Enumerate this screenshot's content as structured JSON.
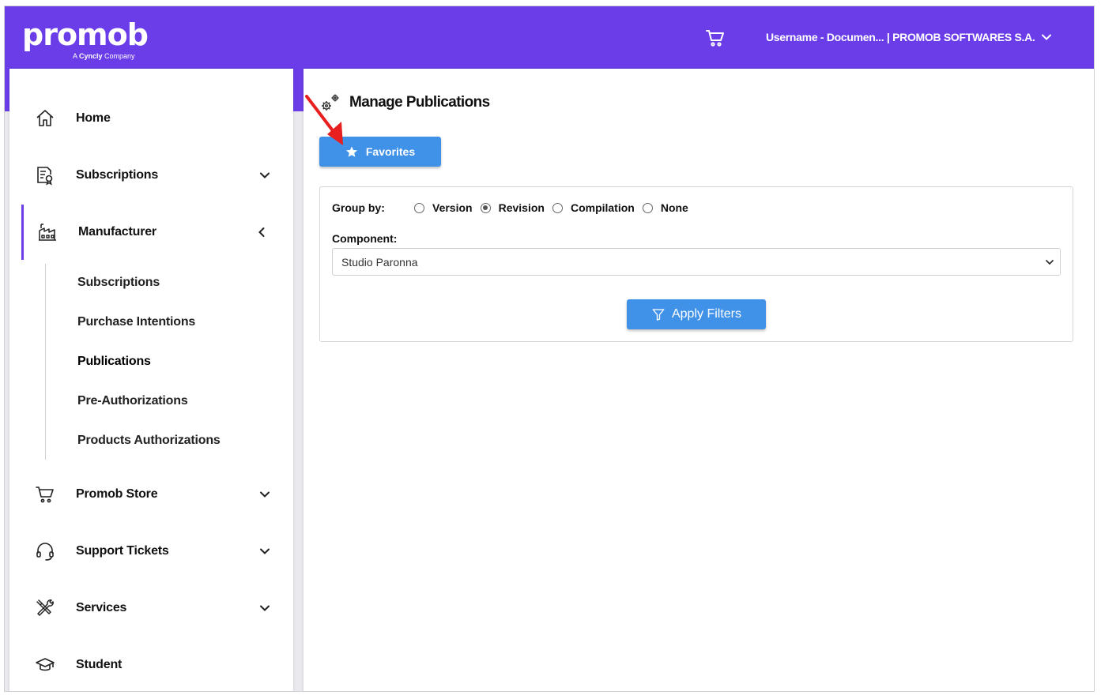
{
  "brand": {
    "logo_text": "promob",
    "tagline_prefix": "A ",
    "tagline_company": "Cyncly",
    "tagline_suffix": " Company"
  },
  "header": {
    "cart_icon": "cart-icon",
    "user_label": "Username - Documen... | PROMOB SOFTWARES S.A.",
    "accent_color": "#6a3de8"
  },
  "sidebar": {
    "items": [
      {
        "label": "Home",
        "icon": "home-icon"
      },
      {
        "label": "Subscriptions",
        "icon": "subscriptions-icon"
      },
      {
        "label": "Manufacturer",
        "icon": "factory-icon"
      },
      {
        "label": "Promob Store",
        "icon": "cart-icon"
      },
      {
        "label": "Support Tickets",
        "icon": "headset-icon"
      },
      {
        "label": "Services",
        "icon": "tools-icon"
      },
      {
        "label": "Student",
        "icon": "graduation-cap-icon"
      }
    ],
    "manufacturer_sub": [
      "Subscriptions",
      "Purchase Intentions",
      "Publications",
      "Pre-Authorizations",
      "Products Authorizations"
    ],
    "current_sub": "Publications"
  },
  "main": {
    "title": "Manage Publications",
    "favorites_label": "Favorites",
    "group_by_label": "Group by:",
    "group_options": [
      "Version",
      "Revision",
      "Compilation",
      "None"
    ],
    "group_selected": "Revision",
    "component_label": "Component:",
    "component_value": "Studio Paronna",
    "apply_label": "Apply Filters",
    "button_color": "#4091e8"
  }
}
